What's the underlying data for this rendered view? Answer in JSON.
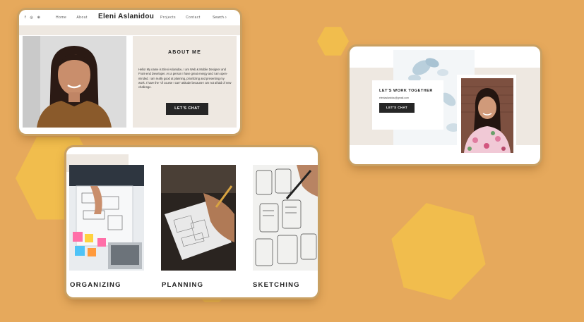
{
  "card1": {
    "nav": {
      "social_icons": [
        "facebook-icon",
        "instagram-icon",
        "globe-icon"
      ],
      "home": "Home",
      "about": "About",
      "brand": "Eleni Aslanidou",
      "projects": "Projects",
      "contact": "Contact",
      "search": "Search"
    },
    "about": {
      "title": "ABOUT ME",
      "text": "Hello! My name is Eleni Aslanidou. I am Web & Mobile Designer and Front-end Developer. As a person I have great energy and I am open-minded. I am really good at planning, prioritizing and presenting my work. I have the \"of course I can\" attitude because I am not afraid of new challenge.",
      "button": "LET'S CHAT"
    }
  },
  "card2": {
    "title": "LET'S WORK TOGETHER",
    "email": "eleniaslanidou@gmail.com",
    "button": "LET'S CHAT"
  },
  "card3": {
    "labels": [
      "ORGANIZING",
      "PLANNING",
      "SKETCHING"
    ]
  },
  "colors": {
    "background": "#e6a95c",
    "hexagon": "#f2c14a",
    "panel_beige": "#eee8e1",
    "button_dark": "#262626"
  }
}
